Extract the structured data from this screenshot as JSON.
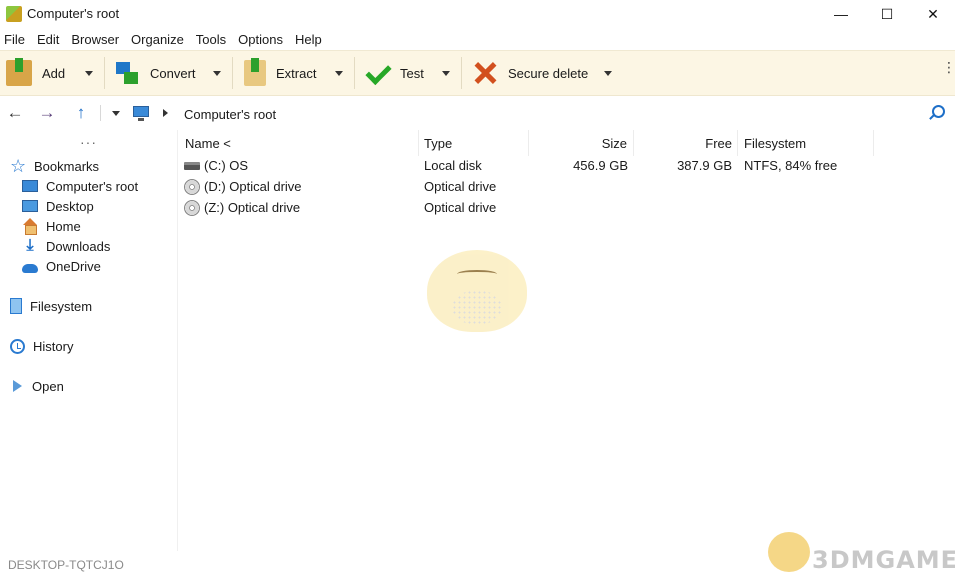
{
  "window": {
    "title": "Computer's root",
    "min_glyph": "—",
    "max_glyph": "☐",
    "close_glyph": "✕"
  },
  "menu": [
    "File",
    "Edit",
    "Browser",
    "Organize",
    "Tools",
    "Options",
    "Help"
  ],
  "toolbar": {
    "add": "Add",
    "convert": "Convert",
    "extract": "Extract",
    "test": "Test",
    "secure_delete": "Secure delete",
    "more_glyph": "⋮"
  },
  "address": {
    "back_glyph": "←",
    "forward_glyph": "→",
    "up_glyph": "↑",
    "path": "Computer's root"
  },
  "sidebar": {
    "dots": "···",
    "bookmarks": "Bookmarks",
    "bookmark_items": [
      "Computer's root",
      "Desktop",
      "Home",
      "Downloads",
      "OneDrive"
    ],
    "filesystem": "Filesystem",
    "history": "History",
    "open": "Open"
  },
  "columns": {
    "name": "Name <",
    "type": "Type",
    "size": "Size",
    "free": "Free",
    "filesystem": "Filesystem"
  },
  "rows": [
    {
      "name": "(C:) OS",
      "type": "Local disk",
      "size": "456.9 GB",
      "free": "387.9 GB",
      "filesystem": "NTFS, 84% free",
      "icon": "disk"
    },
    {
      "name": "(D:) Optical drive",
      "type": "Optical drive",
      "size": "",
      "free": "",
      "filesystem": "",
      "icon": "optical"
    },
    {
      "name": "(Z:) Optical drive",
      "type": "Optical drive",
      "size": "",
      "free": "",
      "filesystem": "",
      "icon": "optical"
    }
  ],
  "status": {
    "computer_name": "DESKTOP-TQTCJ1O"
  },
  "watermark": {
    "text": "3DMGAME"
  }
}
